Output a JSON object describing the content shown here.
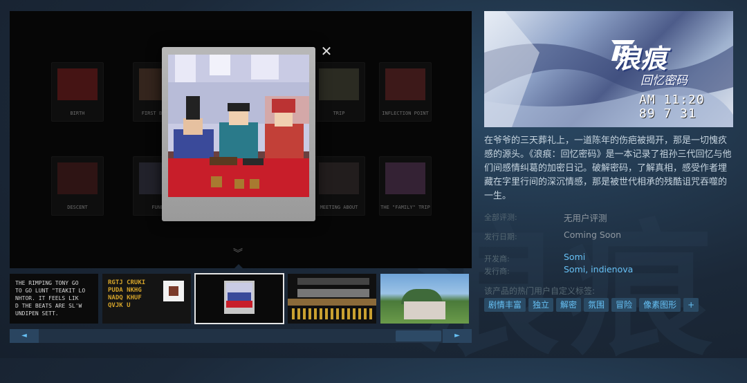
{
  "viewer": {
    "tiles": [
      {
        "label": "BIRTH"
      },
      {
        "label": "FIRST BIRTHD"
      },
      {
        "label": "TRIP"
      },
      {
        "label": "INFLECTION POINT"
      },
      {
        "label": "DESCENT"
      },
      {
        "label": "FUNER"
      },
      {
        "label": "MEETING ABOUT"
      },
      {
        "label": "THE \"FAMILY\" TRIP"
      }
    ]
  },
  "thumbnails": [
    {
      "text": "THE RIMPING TONY GO\nTO GO LUNT \"TEAKIT LO\nNHTOR. IT FEELS LIK\nD THE BEATS ARE SL'W\nUNDIPEN SETT."
    },
    {
      "text": "RGTJ CRUKI\nPUDA NKHG\nNADQ KHUF\nQVJK U"
    },
    {
      "text": ""
    },
    {
      "text": ""
    },
    {
      "text": ""
    }
  ],
  "capsule": {
    "logo_title": "浪痕",
    "logo_subtitle": "回忆密码",
    "stamp_time": "AM 11:20",
    "stamp_date": "89  7 31"
  },
  "description": "在爷爷的三天葬礼上，一道陈年的伤疤被揭开，那是一切愧疚感的源头。《浪痕：回忆密码》是一本记录了祖孙三代回忆与他们间感情纠葛的加密日记。破解密码，了解真相，感受作者埋藏在字里行间的深沉情感，那是被世代相承的残酷诅咒吞噬的一生。",
  "meta": {
    "reviews_label": "全部评测:",
    "reviews_value": "无用户评测",
    "release_label": "发行日期:",
    "release_value": "Coming Soon",
    "developer_label": "开发商:",
    "developer_value": "Somi",
    "publisher_label": "发行商:",
    "publisher_value": "Somi, indienova"
  },
  "tags_label": "该产品的热门用户自定义标签:",
  "tags": [
    "剧情丰富",
    "独立",
    "解密",
    "氛围",
    "冒险",
    "像素图形",
    "+"
  ],
  "scroll": {
    "left": "◄",
    "right": "►"
  },
  "close": "✕",
  "colors": {
    "link": "#67c1f5",
    "tag_bg": "#2a4a64",
    "page_bg": "#1b2838"
  }
}
